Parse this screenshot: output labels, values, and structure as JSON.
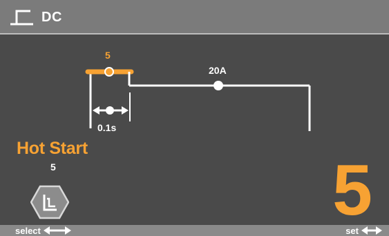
{
  "header": {
    "title": "DC",
    "icon": "dc-waveform-icon"
  },
  "waveform": {
    "hot_start_level_label": "5",
    "current_label": "20A",
    "time_label": "0.1s",
    "hot_start_color": "#f7a233",
    "line_color": "#ffffff"
  },
  "parameter": {
    "name": "Hot Start",
    "small_value": "5",
    "big_value": "5",
    "accent_color": "#f7a233"
  },
  "mode_badge": {
    "icon": "stick-electrode-icon"
  },
  "footer": {
    "select_label": "select",
    "set_label": "set",
    "select_icon": "left-right-arrow-icon",
    "set_icon": "left-right-arrow-icon"
  }
}
